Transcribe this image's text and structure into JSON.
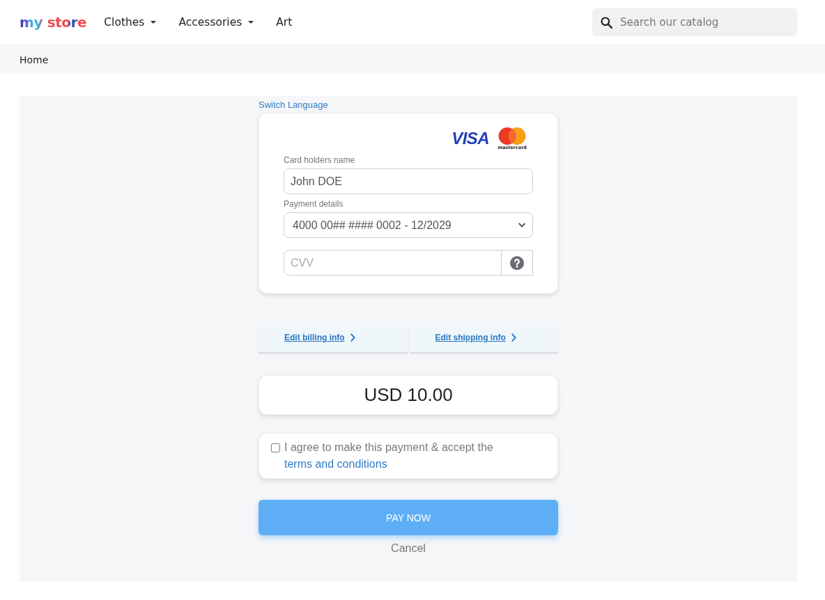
{
  "header": {
    "logo": "my store",
    "nav": [
      {
        "label": "Clothes",
        "dropdown": true
      },
      {
        "label": "Accessories",
        "dropdown": true
      },
      {
        "label": "Art",
        "dropdown": false
      }
    ],
    "search": {
      "placeholder": "Search our catalog"
    }
  },
  "breadcrumb": [
    "Home"
  ],
  "payment": {
    "switch_language": "Switch Language",
    "card_brands": [
      {
        "kind": "visa",
        "label": "VISA"
      },
      {
        "kind": "mastercard",
        "label": "mastercard"
      }
    ],
    "fields": [
      {
        "kind": "text",
        "label": "Card holders name",
        "value": "John DOE"
      },
      {
        "kind": "select",
        "label": "Payment details",
        "value": "4000 00## #### 0002 - 12/2029"
      },
      {
        "kind": "cvv",
        "placeholder": "CVV"
      }
    ],
    "edit_links": [
      "Edit billing info",
      "Edit shipping info"
    ],
    "amount": "USD 10.00",
    "terms": {
      "checked": false,
      "text": "I agree to make this payment & accept the",
      "link": "terms and conditions"
    },
    "pay_button": "PAY NOW",
    "cancel": "Cancel"
  }
}
